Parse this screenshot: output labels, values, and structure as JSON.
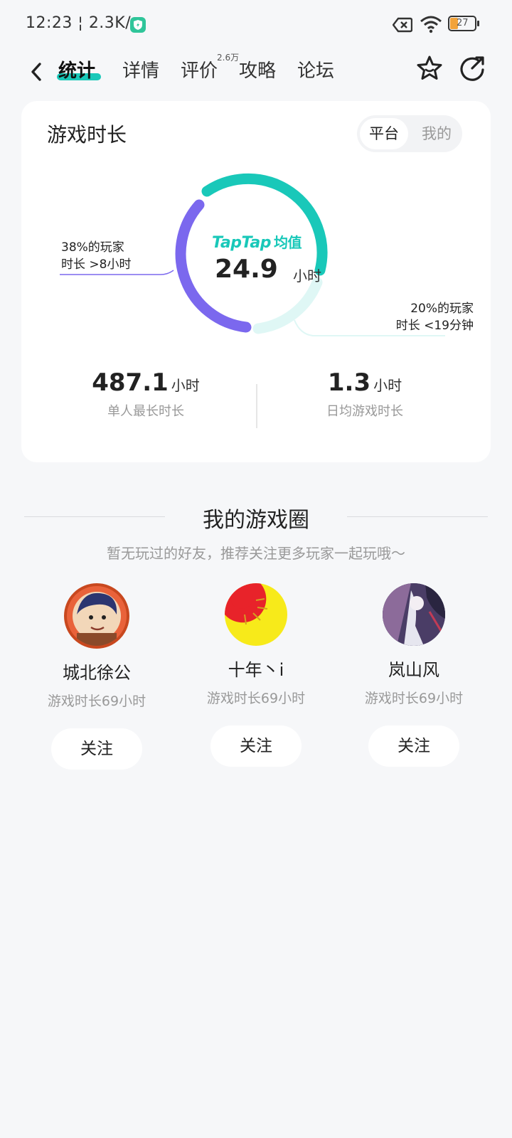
{
  "status_bar": {
    "time": "12:23",
    "network_speed": "2.3K/s",
    "battery": "27"
  },
  "nav": {
    "tabs": [
      {
        "label": "统计",
        "active": true
      },
      {
        "label": "详情"
      },
      {
        "label": "评价",
        "badge": "2.6万"
      },
      {
        "label": "攻略"
      },
      {
        "label": "论坛"
      }
    ],
    "icons": [
      "back-icon",
      "star-icon",
      "share-icon"
    ]
  },
  "playtime_card": {
    "title": "游戏时长",
    "segment": {
      "selected": "平台",
      "other": "我的"
    },
    "brand": "TapTap",
    "avg_label": "均值",
    "avg_value": "24.9",
    "avg_unit": "小时",
    "callout_left_line1": "38%的玩家",
    "callout_left_line2": "时长 >8小时",
    "callout_right_line1": "20%的玩家",
    "callout_right_line2": "时长 <19分钟",
    "donut": {
      "purple_share": 0.38,
      "light_share": 0.2
    },
    "stats": [
      {
        "value": "487.1",
        "unit": "小时",
        "label": "单人最长时长"
      },
      {
        "value": "1.3",
        "unit": "小时",
        "label": "日均游戏时长"
      }
    ],
    "colors": {
      "teal": "#19c8b9",
      "purple": "#7b68ee",
      "light_teal": "#dff7f5"
    }
  },
  "game_circle": {
    "title": "我的游戏圈",
    "subtitle": "暂无玩过的好友，推荐关注更多玩家一起玩哦～",
    "friends": [
      {
        "name": "城北徐公",
        "playtime": "游戏时长69小时",
        "follow": "关注"
      },
      {
        "name": "十年丶i",
        "playtime": "游戏时长69小时",
        "follow": "关注"
      },
      {
        "name": "岚山风",
        "playtime": "游戏时长69小时",
        "follow": "关注"
      }
    ]
  }
}
